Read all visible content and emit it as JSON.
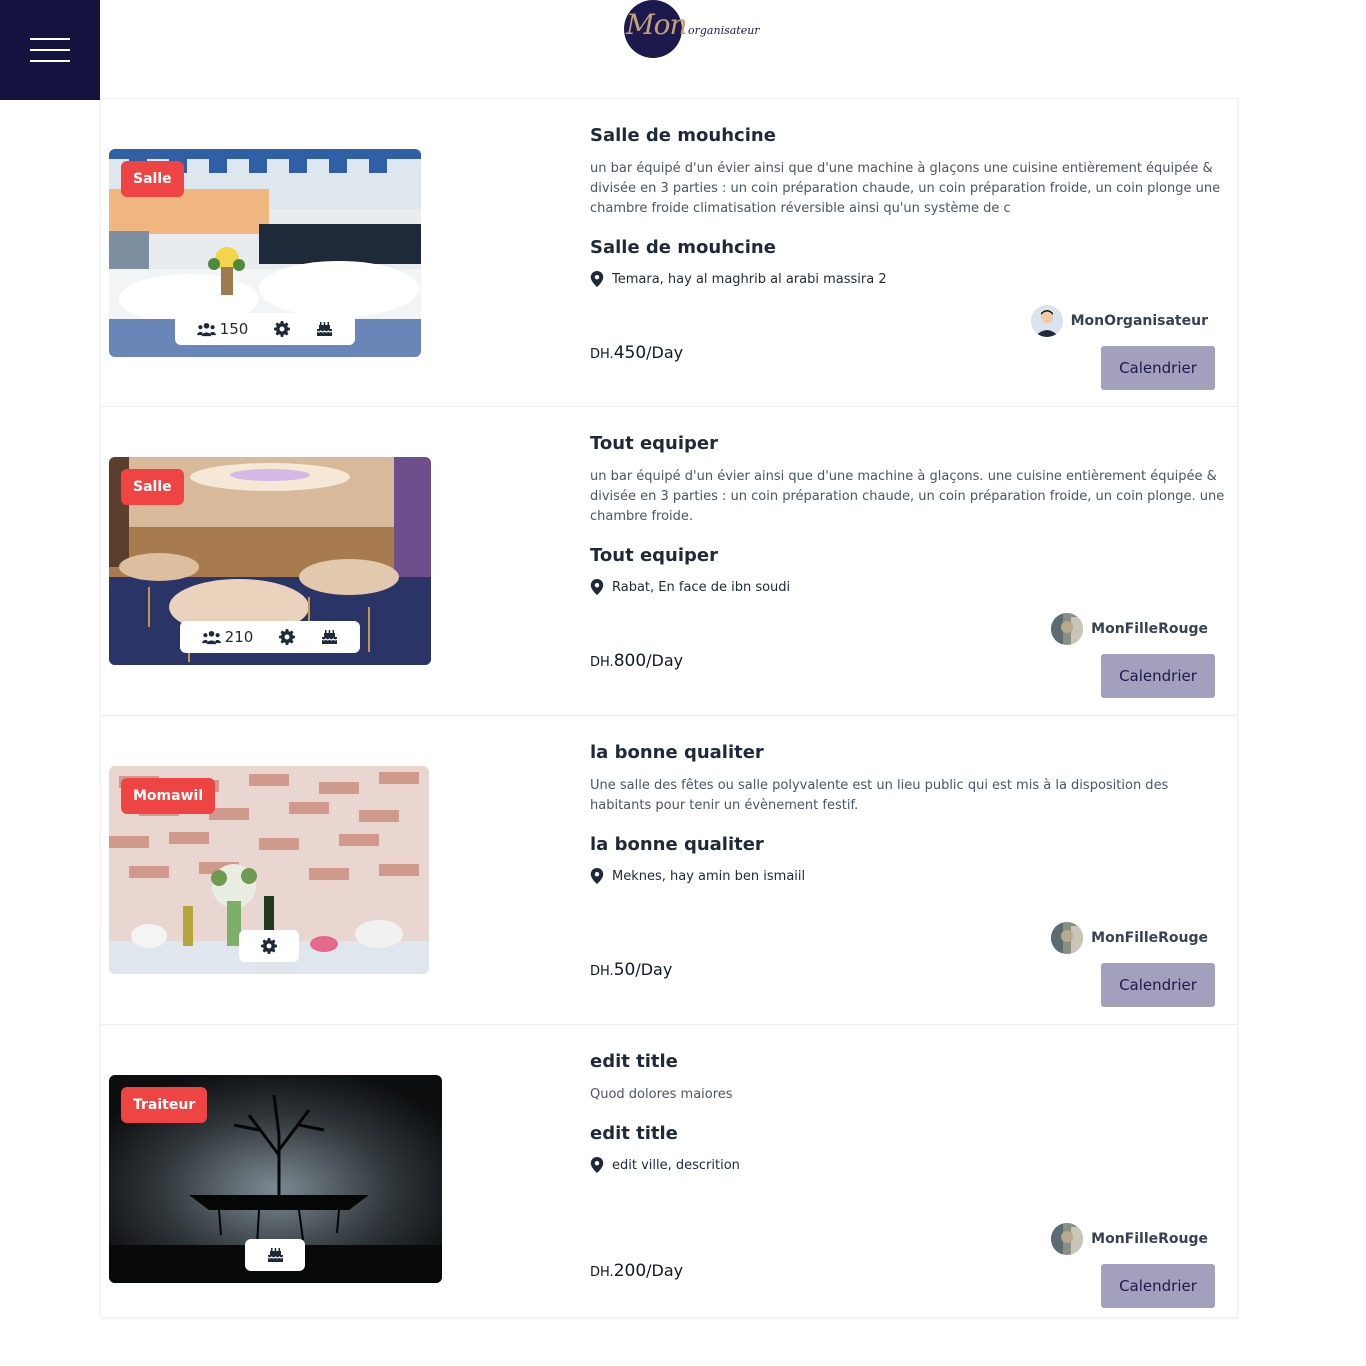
{
  "header": {
    "menu_icon": "hamburger-menu-icon",
    "logo": {
      "script": "Mon",
      "word": "organisateur"
    }
  },
  "colors": {
    "menu_bg": "#14123f",
    "badge": "#ef4444",
    "button": "#a3a0bd",
    "button_text": "#1c1a4d"
  },
  "listings": [
    {
      "badge": "Salle",
      "capacity": "150",
      "features": [
        "users-icon",
        "gear-icon",
        "cake-icon"
      ],
      "title": "Salle de mouhcine",
      "description": "un bar équipé d'un évier ainsi que d'une machine à glaçons une cuisine entièrement équipée & divisée en 3 parties : un coin préparation chaude, un coin préparation froide, un coin plonge une chambre froide climatisation réversible ainsi qu'un système de c",
      "subtitle": "Salle de mouhcine",
      "location": "Temara, hay al maghrib al arabi massira 2",
      "currency": "DH.",
      "amount": "450",
      "period": "/Day",
      "owner": "MonOrganisateur",
      "button": "Calendrier"
    },
    {
      "badge": "Salle",
      "capacity": "210",
      "features": [
        "users-icon",
        "gear-icon",
        "cake-icon"
      ],
      "title": "Tout equiper",
      "description": "un bar équipé d'un évier ainsi que d'une machine à glaçons. une cuisine entièrement équipée & divisée en 3 parties : un coin préparation chaude, un coin préparation froide, un coin plonge. une chambre froide.",
      "subtitle": "Tout equiper",
      "location": "Rabat, En face de ibn soudi",
      "currency": "DH.",
      "amount": "800",
      "period": "/Day",
      "owner": "MonFilleRouge",
      "button": "Calendrier"
    },
    {
      "badge": "Momawil",
      "features": [
        "gear-icon"
      ],
      "title": "la bonne qualiter",
      "description": "Une salle des fêtes ou salle polyvalente est un lieu public qui est mis à la disposition des habitants pour tenir un évènement festif.",
      "subtitle": "la bonne qualiter",
      "location": "Meknes, hay amin ben ismaiil",
      "currency": "DH.",
      "amount": "50",
      "period": "/Day",
      "owner": "MonFilleRouge",
      "button": "Calendrier"
    },
    {
      "badge": "Traiteur",
      "features": [
        "cake-icon"
      ],
      "title": "edit title",
      "description": "Quod dolores maiores",
      "subtitle": "edit title",
      "location": "edit ville, descrition",
      "currency": "DH.",
      "amount": "200",
      "period": "/Day",
      "owner": "MonFilleRouge",
      "button": "Calendrier"
    }
  ]
}
